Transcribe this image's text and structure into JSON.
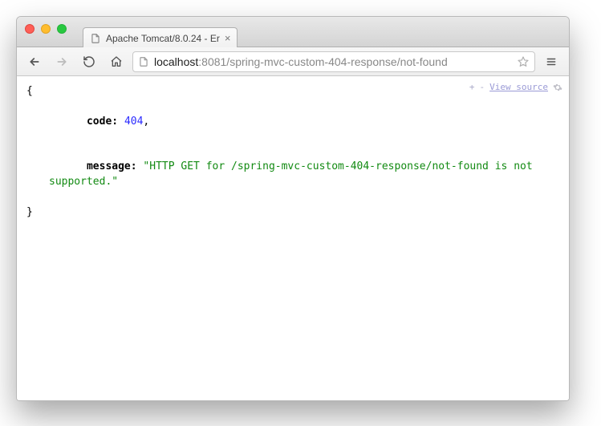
{
  "window": {
    "tab_title": "Apache Tomcat/8.0.24 - Er"
  },
  "toolbar": {
    "url_host": "localhost",
    "url_path": ":8081/spring-mvc-custom-404-response/not-found"
  },
  "extension": {
    "plus": "+",
    "minus": "-",
    "view_source": "View source"
  },
  "json": {
    "open": "{",
    "close": "}",
    "code_key": "code:",
    "code_value": "404",
    "code_comma": ",",
    "message_key": "message:",
    "message_value": "\"HTTP GET for /spring-mvc-custom-404-response/not-found is not supported.\""
  }
}
